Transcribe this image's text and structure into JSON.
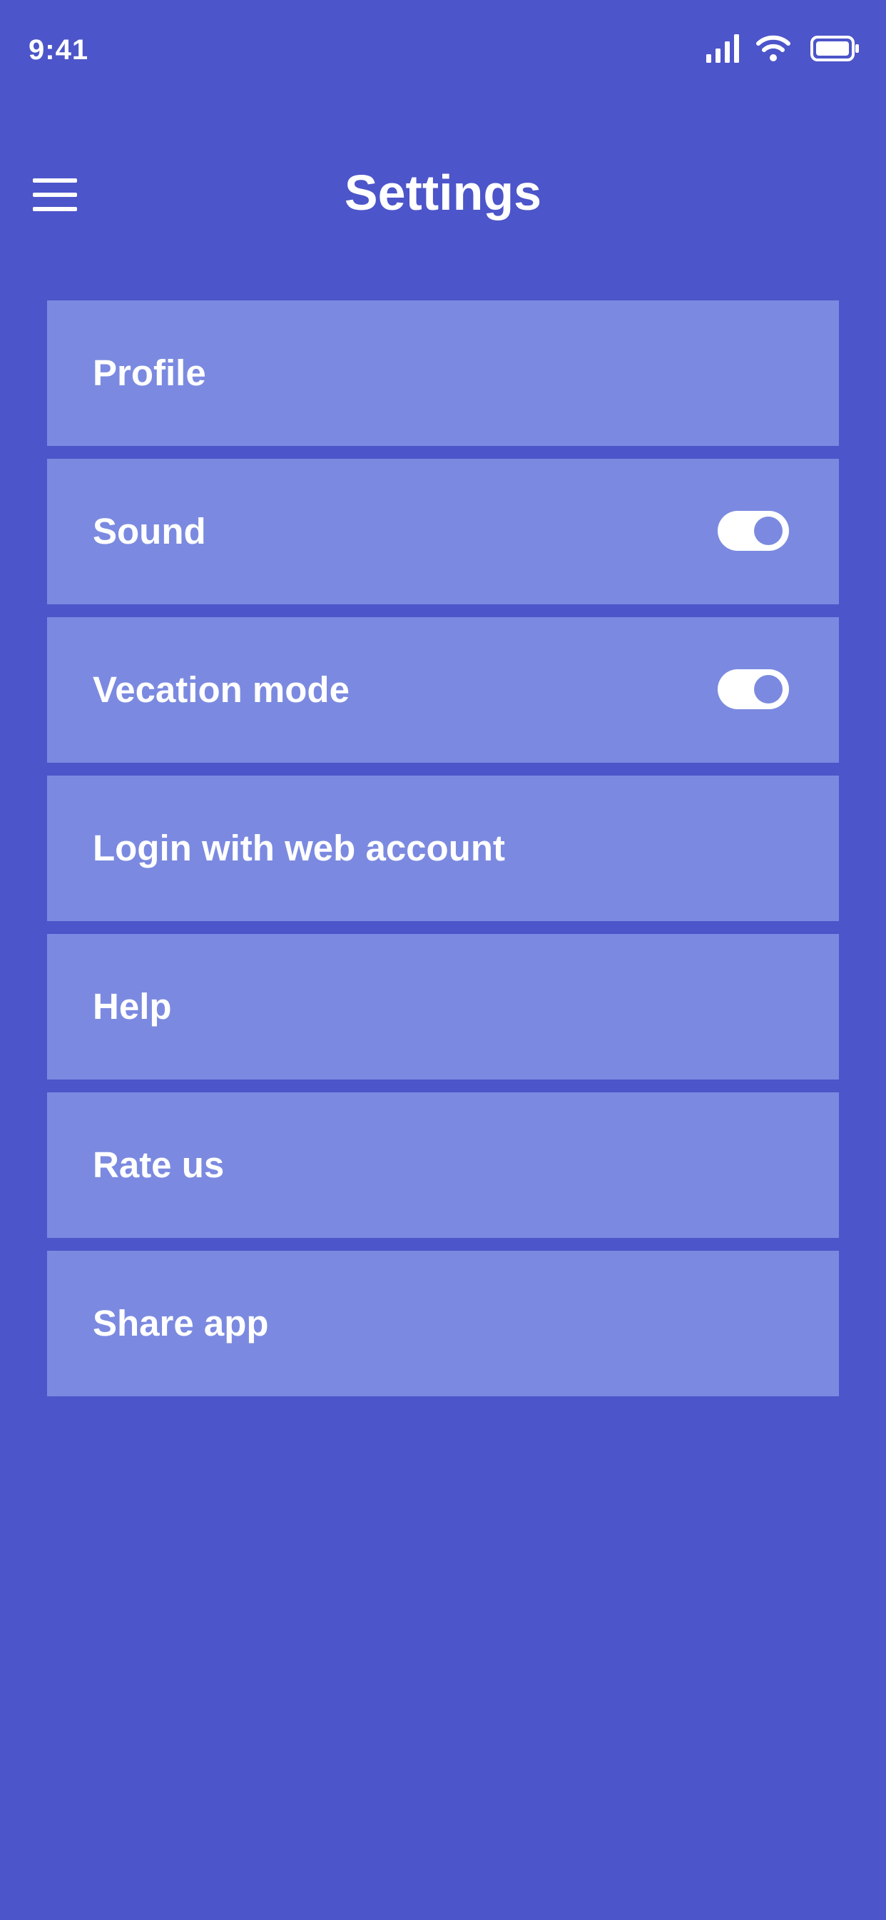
{
  "status_bar": {
    "time": "9:41"
  },
  "header": {
    "title": "Settings"
  },
  "settings": {
    "items": [
      {
        "label": "Profile"
      },
      {
        "label": "Sound",
        "toggle": "on"
      },
      {
        "label": "Vecation mode",
        "toggle": "on"
      },
      {
        "label": "Login with web account"
      },
      {
        "label": "Help"
      },
      {
        "label": "Rate us"
      },
      {
        "label": "Share app"
      }
    ]
  },
  "colors": {
    "background": "#4C55C9",
    "item_background": "#7B8AE0",
    "text": "#FFFFFF"
  },
  "icons": {
    "menu": "menu-icon",
    "signal": "signal-icon",
    "wifi": "wifi-icon",
    "battery": "battery-icon"
  }
}
